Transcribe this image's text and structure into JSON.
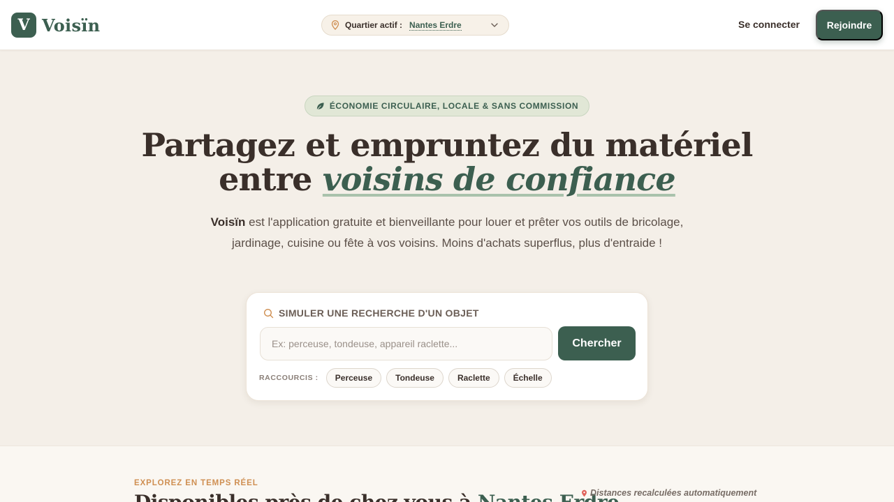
{
  "header": {
    "logo_letter": "V",
    "logo_name": "Voisïn",
    "district_label": "Quartier actif :",
    "district_value": "Nantes Erdre",
    "login_label": "Se connecter",
    "join_label": "Rejoindre"
  },
  "hero": {
    "badge": "ÉCONOMIE CIRCULAIRE, LOCALE & SANS COMMISSION",
    "headline_line1": "Partagez et empruntez du matériel",
    "headline_prefix": "entre",
    "headline_accent": "voisins de confiance",
    "lead_brand": "Voisïn",
    "lead_text": "est l'application gratuite et bienveillante pour louer et prêter vos outils de bricolage, jardinage, cuisine ou fête à vos voisins. Moins d'achats superflus, plus d'entraide !"
  },
  "search": {
    "title": "SIMULER UNE RECHERCHE D'UN OBJET",
    "placeholder": "Ex: perceuse, tondeuse, appareil raclette...",
    "value": "",
    "button": "Chercher",
    "shortcuts_label": "RACCOURCIS :",
    "shortcuts": [
      "Perceuse",
      "Tondeuse",
      "Raclette",
      "Échelle"
    ]
  },
  "section": {
    "eyebrow": "EXPLOREZ EN TEMPS RÉEL",
    "title_prefix": "Disponibles près de chez vous à",
    "title_accent": "Nantes Erdre",
    "distance_note": "Distances recalculées automatiquement"
  },
  "colors": {
    "brand": "#3c5f50",
    "background": "#f4efe8",
    "accent_orange": "#cf8f52",
    "badge_bg": "#e1e7d6"
  },
  "icons": {
    "district": "map-pin-icon",
    "district_chevron": "chevron-down-icon",
    "badge": "leaf-icon",
    "search": "search-icon",
    "note": "map-pin-icon"
  }
}
